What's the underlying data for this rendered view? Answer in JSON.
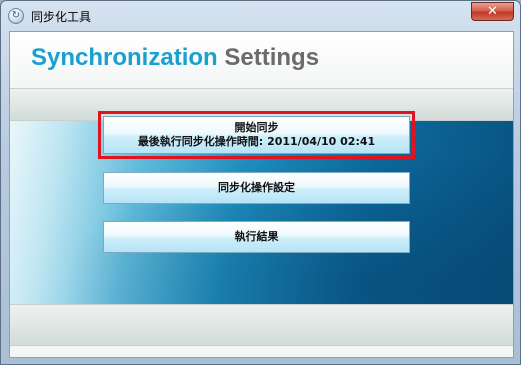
{
  "window": {
    "title": "同步化工具",
    "close_label": "✕",
    "app_icon_glyph": "↻"
  },
  "header": {
    "title_part1": "Synchronization",
    "title_part2": "Settings",
    "colors": {
      "accent": "#1aa0cf",
      "secondary": "#6b6b6b"
    }
  },
  "buttons": {
    "start_sync": {
      "label": "開始同步",
      "last_run_prefix": "最後執行同步化操作時間:",
      "last_run_time": "2011/04/10 02:41",
      "highlight_color": "#e0141f"
    },
    "sync_settings": {
      "label": "同步化操作設定"
    },
    "results": {
      "label": "執行結果"
    }
  }
}
